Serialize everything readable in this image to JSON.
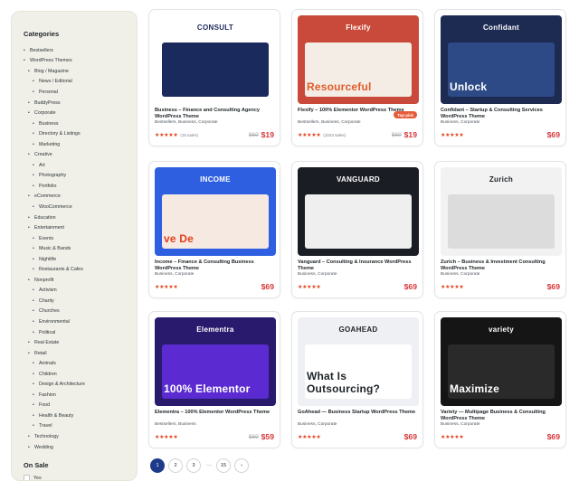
{
  "sidebar": {
    "categories_title": "Categories",
    "categories": [
      {
        "label": "Bestsellers",
        "level": 0
      },
      {
        "label": "WordPress Themes",
        "level": 0
      },
      {
        "label": "Blog / Magazine",
        "level": 1
      },
      {
        "label": "News / Editorial",
        "level": 2
      },
      {
        "label": "Personal",
        "level": 2
      },
      {
        "label": "BuddyPress",
        "level": 1
      },
      {
        "label": "Corporate",
        "level": 1
      },
      {
        "label": "Business",
        "level": 2
      },
      {
        "label": "Directory & Listings",
        "level": 2
      },
      {
        "label": "Marketing",
        "level": 2
      },
      {
        "label": "Creative",
        "level": 1
      },
      {
        "label": "Art",
        "level": 2
      },
      {
        "label": "Photography",
        "level": 2
      },
      {
        "label": "Portfolio",
        "level": 2
      },
      {
        "label": "eCommerce",
        "level": 1
      },
      {
        "label": "WooCommerce",
        "level": 2
      },
      {
        "label": "Education",
        "level": 1
      },
      {
        "label": "Entertainment",
        "level": 1
      },
      {
        "label": "Events",
        "level": 2
      },
      {
        "label": "Music & Bands",
        "level": 2
      },
      {
        "label": "Nightlife",
        "level": 2
      },
      {
        "label": "Restaurants & Cafes",
        "level": 2
      },
      {
        "label": "Nonprofit",
        "level": 1
      },
      {
        "label": "Activism",
        "level": 2
      },
      {
        "label": "Charity",
        "level": 2
      },
      {
        "label": "Churches",
        "level": 2
      },
      {
        "label": "Environmental",
        "level": 2
      },
      {
        "label": "Political",
        "level": 2
      },
      {
        "label": "Real Estate",
        "level": 1
      },
      {
        "label": "Retail",
        "level": 1
      },
      {
        "label": "Animals",
        "level": 2
      },
      {
        "label": "Children",
        "level": 2
      },
      {
        "label": "Design & Architecture",
        "level": 2
      },
      {
        "label": "Fashion",
        "level": 2
      },
      {
        "label": "Food",
        "level": 2
      },
      {
        "label": "Health & Beauty",
        "level": 2
      },
      {
        "label": "Travel",
        "level": 2
      },
      {
        "label": "Technology",
        "level": 1
      },
      {
        "label": "Wedding",
        "level": 1
      }
    ],
    "on_sale_title": "On Sale",
    "on_sale_option": "Yes"
  },
  "products": [
    {
      "brand": "CONSULT",
      "title": "Business – Finance and Consulting Agency WordPress Theme",
      "cats": "Bestsellers, Business, Corporate",
      "stars": "★★★★★",
      "sales": "(15 sales)",
      "old_price": "$69",
      "price": "$19",
      "badge": "",
      "bg": "#ffffff",
      "hero": "#1b2a5c",
      "brand_color": "#1b2a5c",
      "hero_text": "",
      "hero_text_color": "#ffffff"
    },
    {
      "brand": "Flexify",
      "title": "Flexify – 100% Elementor WordPress Theme",
      "cats": "Bestsellers, Business, Corporate",
      "stars": "★★★★★",
      "sales": "(1043 sales)",
      "old_price": "$69",
      "price": "$19",
      "badge": "Top pick",
      "bg": "#c94a3a",
      "hero": "#f3ede6",
      "brand_color": "#ffffff",
      "hero_text": "Resourceful",
      "hero_text_color": "#e25b2a"
    },
    {
      "brand": "Confidant",
      "title": "Confidant – Startup & Consulting Services WordPress Theme",
      "cats": "Business, Corporate",
      "stars": "★★★★★",
      "sales": "",
      "old_price": "",
      "price": "$69",
      "badge": "",
      "bg": "#1d2a52",
      "hero": "#2e4a86",
      "brand_color": "#ffffff",
      "hero_text": "Unlock",
      "hero_text_color": "#ffffff"
    },
    {
      "brand": "INCOME",
      "title": "Income – Finance & Consulting Business WordPress Theme",
      "cats": "Business, Corporate",
      "stars": "★★★★★",
      "sales": "",
      "old_price": "",
      "price": "$69",
      "badge": "",
      "bg": "#2d5fe0",
      "hero": "#f6e9e2",
      "brand_color": "#ffffff",
      "hero_text": "ve De",
      "hero_text_color": "#e2401c"
    },
    {
      "brand": "VANGUARD",
      "title": "Vanguard – Consulting & Insurance WordPress Theme",
      "cats": "Business, Corporate",
      "stars": "★★★★★",
      "sales": "",
      "old_price": "",
      "price": "$69",
      "badge": "",
      "bg": "#1a1d24",
      "hero": "#efefef",
      "brand_color": "#ffffff",
      "hero_text": "",
      "hero_text_color": "#ffffff"
    },
    {
      "brand": "Zurich",
      "title": "Zurich – Business & Investment Consulting WordPress Theme",
      "cats": "Business, Corporate",
      "stars": "★★★★★",
      "sales": "",
      "old_price": "",
      "price": "$69",
      "badge": "",
      "bg": "#f2f2f2",
      "hero": "#dcdcdc",
      "brand_color": "#1d2327",
      "hero_text": "",
      "hero_text_color": "#1d2327"
    },
    {
      "brand": "Elementra",
      "title": "Elementra – 100% Elementor WordPress Theme",
      "cats": "Bestsellers, Business",
      "stars": "★★★★★",
      "sales": "",
      "old_price": "$69",
      "price": "$59",
      "badge": "",
      "bg": "#2a1a6e",
      "hero": "#5b2bd1",
      "brand_color": "#ffffff",
      "hero_text": "100% Elementor",
      "hero_text_color": "#ffffff"
    },
    {
      "brand": "GOAHEAD",
      "title": "GoAhead — Business Startup WordPress Theme",
      "cats": "Business, Corporate",
      "stars": "★★★★★",
      "sales": "",
      "old_price": "",
      "price": "$69",
      "badge": "",
      "bg": "#eef0f3",
      "hero": "#ffffff",
      "brand_color": "#1d2327",
      "hero_text": "What Is Outsourcing?",
      "hero_text_color": "#1d2327"
    },
    {
      "brand": "variety",
      "title": "Variety — Multipage Business & Consulting WordPress Theme",
      "cats": "Business, Corporate",
      "stars": "★★★★★",
      "sales": "",
      "old_price": "",
      "price": "$69",
      "badge": "",
      "bg": "#151515",
      "hero": "#2a2a2a",
      "brand_color": "#ffffff",
      "hero_text": "Maximize",
      "hero_text_color": "#ffffff"
    }
  ],
  "pagination": {
    "pages": [
      "1",
      "2",
      "3"
    ],
    "dots": "···",
    "last": "15",
    "next": "›"
  }
}
